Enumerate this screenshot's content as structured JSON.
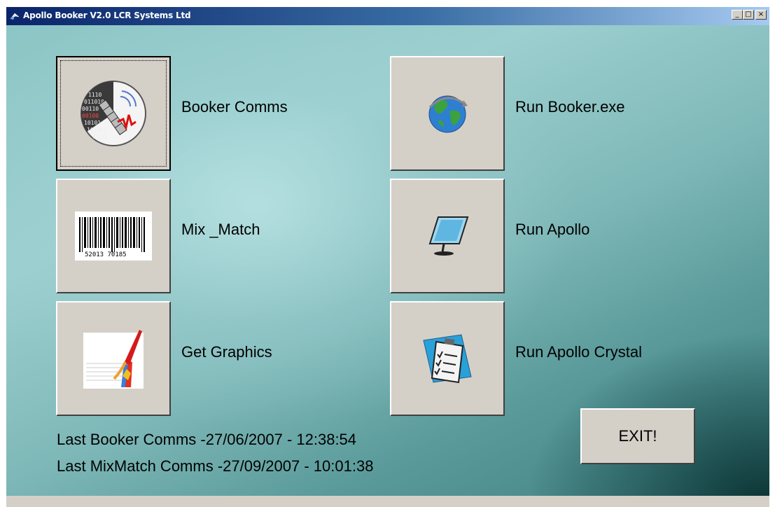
{
  "window": {
    "title": "Apollo Booker V2.0 LCR Systems Ltd",
    "minimize_glyph": "_",
    "maximize_glyph": "□",
    "close_glyph": "×"
  },
  "buttons": [
    {
      "id": "booker-comms",
      "label": "Booker Comms",
      "icon": "satellite-binary-icon"
    },
    {
      "id": "run-booker",
      "label": "Run Booker.exe",
      "icon": "globe-icon"
    },
    {
      "id": "mix-match",
      "label": "Mix _Match",
      "icon": "barcode-icon"
    },
    {
      "id": "run-apollo",
      "label": "Run Apollo",
      "icon": "monitor-icon"
    },
    {
      "id": "get-graphics",
      "label": "Get Graphics",
      "icon": "graphics-chart-icon"
    },
    {
      "id": "run-apollo-crystal",
      "label": "Run Apollo Crystal",
      "icon": "clipboard-icon"
    }
  ],
  "barcode_digits": "52013 70185",
  "status": {
    "last_booker": "Last Booker Comms -27/06/2007 - 12:38:54",
    "last_mixmatch": "Last MixMatch Comms -27/09/2007 - 10:01:38"
  },
  "exit_label": "EXIT!",
  "colors": {
    "titlebar_start": "#0a246a",
    "titlebar_end": "#a6caf0",
    "button_face": "#d4d0c8",
    "background_teal": "#8cc5c5"
  }
}
